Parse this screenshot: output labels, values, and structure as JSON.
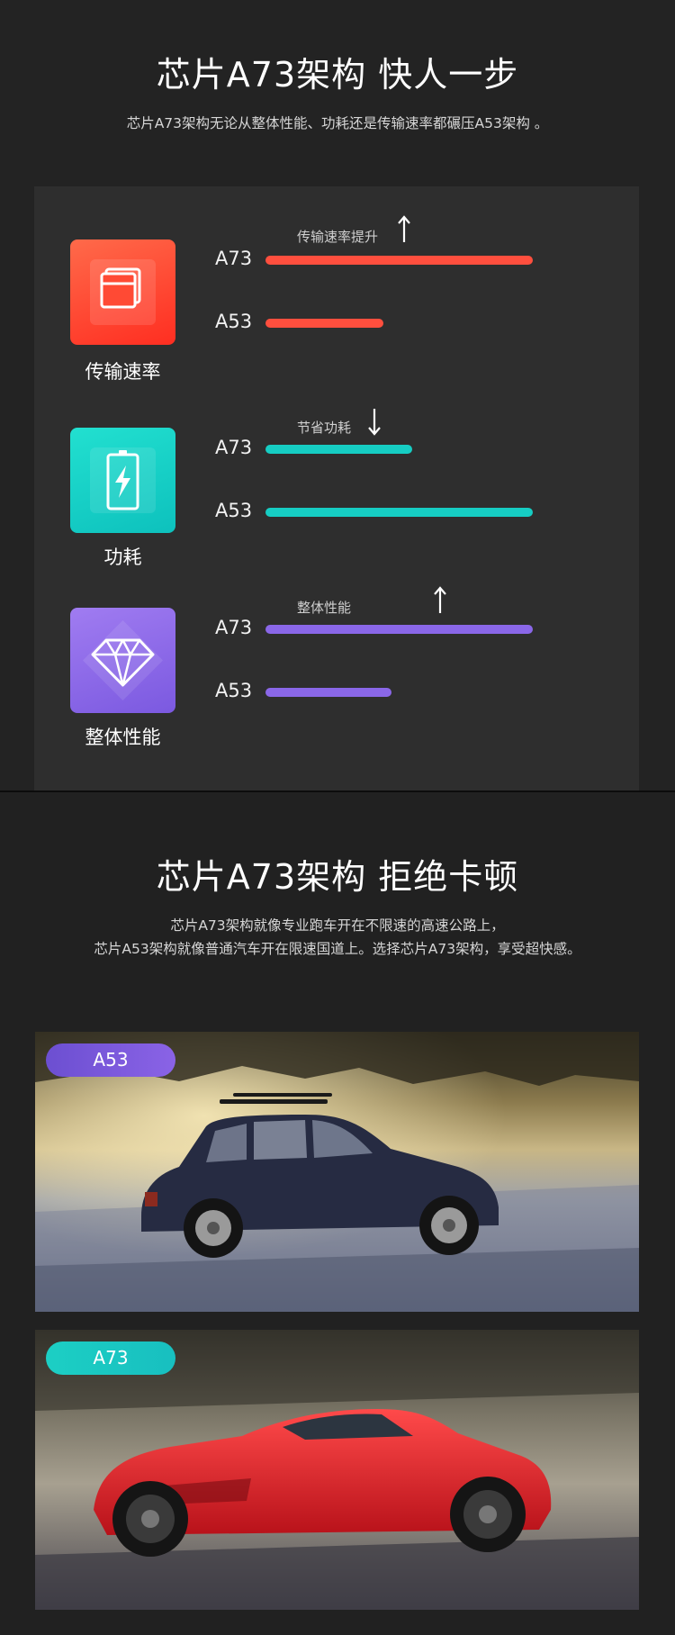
{
  "section1": {
    "title": "芯片A73架构  快人一步",
    "subtitle": "芯片A73架构无论从整体性能、功耗还是传输速率都碾压A53架构 。"
  },
  "metrics": [
    {
      "label": "传输速率",
      "note": "传输速率提升",
      "trend": "up",
      "icon": "window-stack-icon",
      "color": "#ff4f3e",
      "bars": [
        {
          "chip": "A73",
          "value": 1.0
        },
        {
          "chip": "A53",
          "value": 0.44
        }
      ]
    },
    {
      "label": "功耗",
      "note": "节省功耗",
      "trend": "down",
      "icon": "battery-icon",
      "color": "#16cdc3",
      "bars": [
        {
          "chip": "A73",
          "value": 0.55
        },
        {
          "chip": "A53",
          "value": 1.0
        }
      ]
    },
    {
      "label": "整体性能",
      "note": "整体性能",
      "trend": "up",
      "icon": "diamond-icon",
      "color": "#8a67e8",
      "bars": [
        {
          "chip": "A73",
          "value": 1.0
        },
        {
          "chip": "A53",
          "value": 0.47
        }
      ]
    }
  ],
  "section2": {
    "title": "芯片A73架构 拒绝卡顿",
    "line1": "芯片A73架构就像专业跑车开在不限速的高速公路上，",
    "line2": "芯片A53架构就像普通汽车开在限速国道上。选择芯片A73架构，享受超快感。"
  },
  "photos": [
    {
      "tag": "A53",
      "subject": "hatchback-car-photo"
    },
    {
      "tag": "A73",
      "subject": "sports-car-photo"
    }
  ],
  "colors": {
    "a53_tag": "#6c4fd1",
    "a73_tag": "#1ccfc4"
  }
}
